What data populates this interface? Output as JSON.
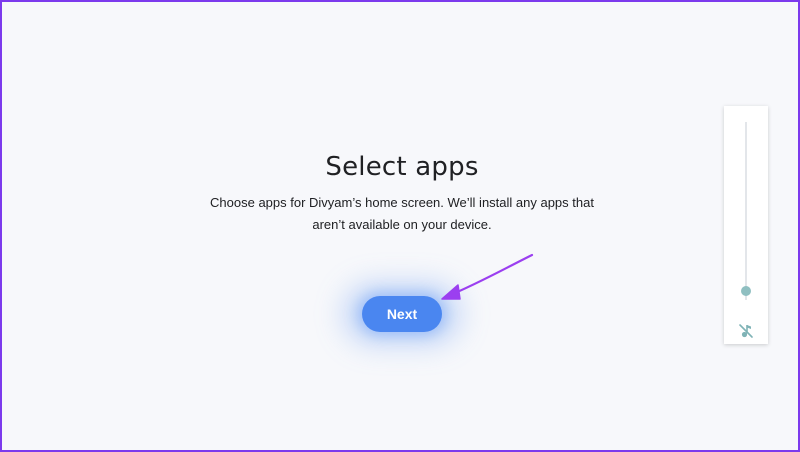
{
  "setup": {
    "title": "Select apps",
    "description": "Choose apps for Divyam’s home screen. We’ll install any apps that aren’t available on your device.",
    "next_label": "Next"
  },
  "volume_panel": {
    "level": 0.05,
    "muted": true,
    "icon": "music-note-off-icon"
  },
  "annotation": {
    "icon": "arrow-pointer-icon",
    "color": "#9b3ff0"
  },
  "colors": {
    "frame_border": "#7c3aed",
    "background": "#f7f8fb",
    "accent": "#4a86f0",
    "slider": "#8fbfc1"
  }
}
